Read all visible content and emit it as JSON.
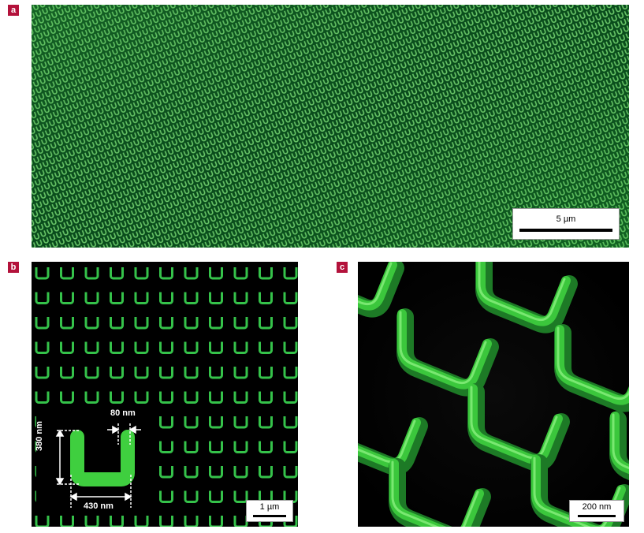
{
  "panels": {
    "a": {
      "label": "a",
      "scale_bar": "5 µm"
    },
    "b": {
      "label": "b",
      "scale_bar": "1 µm",
      "dimensions": {
        "gap": "80 nm",
        "height": "380 nm",
        "width": "430 nm"
      }
    },
    "c": {
      "label": "c",
      "scale_bar": "200 nm"
    }
  },
  "colors": {
    "label_bg": "#b3123b",
    "structure_green": "#3fcf3f",
    "background": "#000000"
  }
}
